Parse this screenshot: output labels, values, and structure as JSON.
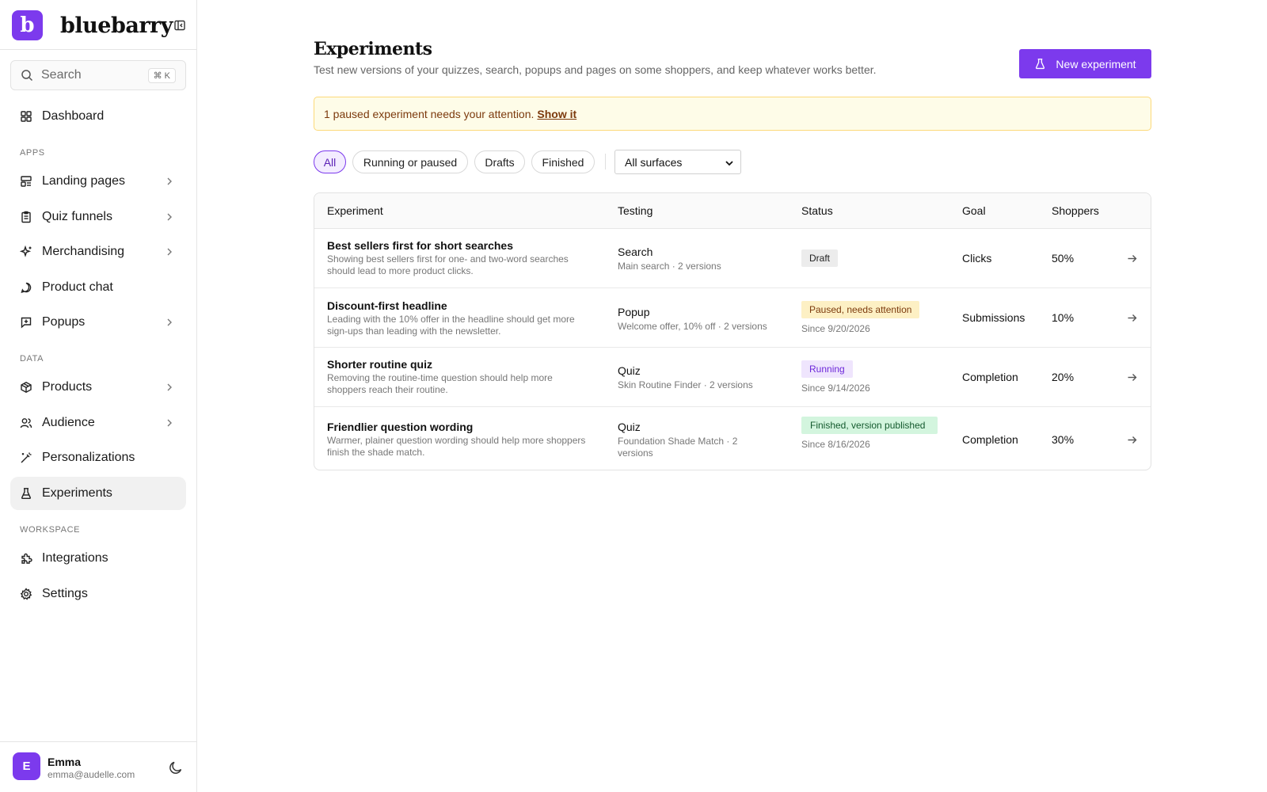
{
  "brand": {
    "name": "bluebarry",
    "logo_letter": "b",
    "accent": "#7c3aed"
  },
  "search": {
    "placeholder": "Search",
    "shortcut": "⌘ K"
  },
  "sidebar": {
    "dashboard": "Dashboard",
    "sections": {
      "apps": "APPS",
      "data": "DATA",
      "workspace": "WORKSPACE"
    },
    "items": {
      "landing_pages": "Landing pages",
      "quiz_funnels": "Quiz funnels",
      "merchandising": "Merchandising",
      "product_chat": "Product chat",
      "popups": "Popups",
      "products": "Products",
      "audience": "Audience",
      "personalizations": "Personalizations",
      "experiments": "Experiments",
      "integrations": "Integrations",
      "settings": "Settings"
    },
    "active": "experiments"
  },
  "user": {
    "initial": "E",
    "name": "Emma",
    "email": "emma@audelle.com"
  },
  "page": {
    "title": "Experiments",
    "subtitle": "Test new versions of your quizzes, search, popups and pages on some shoppers, and keep whatever works better.",
    "new_button": "New experiment"
  },
  "alert": {
    "text": "1 paused experiment needs your attention.",
    "link": "Show it"
  },
  "filters": {
    "chips": [
      "All",
      "Running or paused",
      "Drafts",
      "Finished"
    ],
    "active": "All",
    "surface_select": "All surfaces"
  },
  "table": {
    "columns": [
      "Experiment",
      "Testing",
      "Status",
      "Goal",
      "Shoppers"
    ],
    "rows": [
      {
        "title": "Best sellers first for short searches",
        "description": "Showing best sellers first for one- and two-word searches should lead to more product clicks.",
        "testing": "Search",
        "testing_sub": "Main search · 2 versions",
        "status": "Draft",
        "since": "",
        "goal": "Clicks",
        "shoppers": "50%"
      },
      {
        "title": "Discount-first headline",
        "description": "Leading with the 10% offer in the headline should get more sign-ups than leading with the newsletter.",
        "testing": "Popup",
        "testing_sub": "Welcome offer, 10% off · 2 versions",
        "status": "Paused, needs attention",
        "since": "Since 9/20/2026",
        "goal": "Submissions",
        "shoppers": "10%"
      },
      {
        "title": "Shorter routine quiz",
        "description": "Removing the routine-time question should help more shoppers reach their routine.",
        "testing": "Quiz",
        "testing_sub": "Skin Routine Finder · 2 versions",
        "status": "Running",
        "since": "Since 9/14/2026",
        "goal": "Completion",
        "shoppers": "20%"
      },
      {
        "title": "Friendlier question wording",
        "description": "Warmer, plainer question wording should help more shoppers finish the shade match.",
        "testing": "Quiz",
        "testing_sub": "Foundation Shade Match · 2 versions",
        "status": "Finished, version published",
        "since": "Since 8/16/2026",
        "goal": "Completion",
        "shoppers": "30%"
      }
    ]
  }
}
